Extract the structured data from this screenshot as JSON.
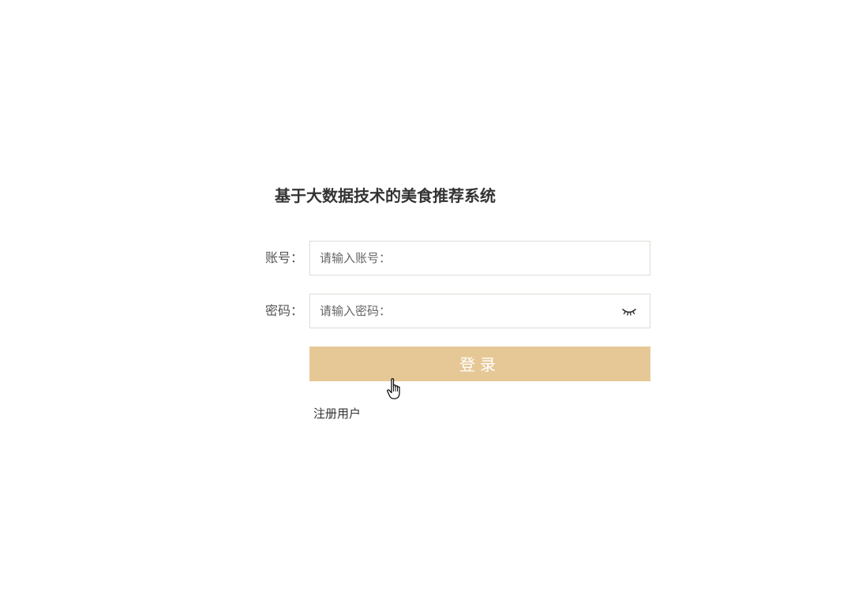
{
  "app": {
    "title": "基于大数据技术的美食推荐系统"
  },
  "form": {
    "account": {
      "label": "账号：",
      "placeholder": "请输入账号：",
      "value": ""
    },
    "password": {
      "label": "密码：",
      "placeholder": "请输入密码：",
      "value": "",
      "toggle_icon": "eye-closed-icon"
    },
    "login_label": "登录",
    "register_label": "注册用户"
  },
  "colors": {
    "accent": "#e6c896",
    "text": "#333333",
    "border": "#dfdcd6"
  },
  "cursor": {
    "icon": "hand-pointer-icon"
  }
}
